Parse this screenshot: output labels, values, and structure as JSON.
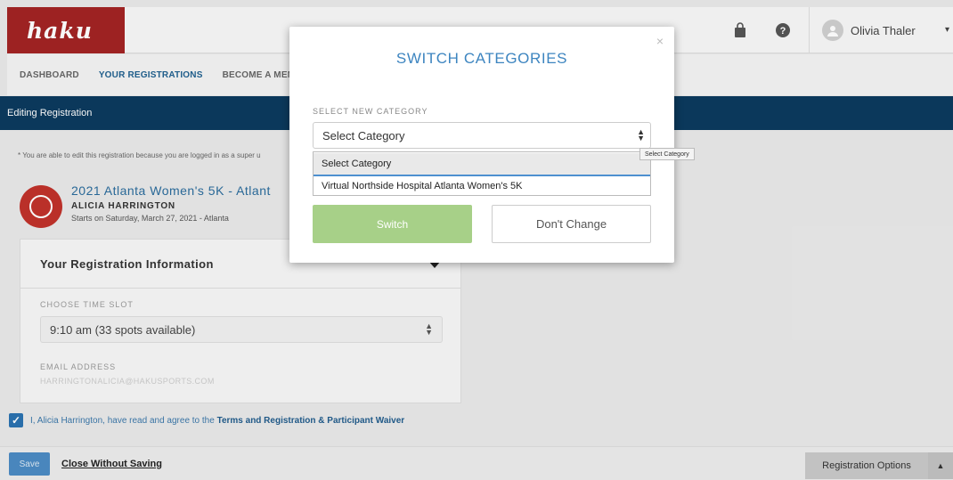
{
  "app": {
    "logo_text": "haku"
  },
  "header": {
    "user_name": "Olivia Thaler"
  },
  "nav": {
    "items": [
      "DASHBOARD",
      "YOUR REGISTRATIONS",
      "BECOME A MEMBE"
    ]
  },
  "edit_bar": {
    "title": "Editing Registration"
  },
  "notice": "* You are able to edit this registration because you are logged in as a super u",
  "event": {
    "title": "2021 Atlanta Women's 5K - Atlant",
    "person": "ALICIA HARRINGTON",
    "date": "Starts on Saturday, March 27, 2021 - Atlanta"
  },
  "registration_panel": {
    "title": "Your Registration Information",
    "time_slot_label": "CHOOSE TIME SLOT",
    "time_slot_value": "9:10 am (33 spots available)",
    "email_label": "EMAIL ADDRESS",
    "email_value": "HARRINGTONALICIA@HAKUSPORTS.COM"
  },
  "agreement": {
    "text": "I, Alicia Harrington, have read and agree to the ",
    "link": "Terms and Registration & Participant Waiver",
    "checked": true
  },
  "footer": {
    "save_label": "Save",
    "close_label": "Close Without Saving",
    "options_label": "Registration Options"
  },
  "modal": {
    "title": "SWITCH CATEGORIES",
    "close_glyph": "×",
    "select_label": "SELECT NEW CATEGORY",
    "select_value": "Select Category",
    "options": [
      "Select Category",
      "Virtual Northside Hospital Atlanta Women's 5K"
    ],
    "switch_label": "Switch",
    "dont_change_label": "Don't Change"
  },
  "tooltip": "Select Category",
  "colors": {
    "brand_red": "#a32424",
    "nav_dark": "#0c3a5e",
    "accent_blue": "#3d85c0",
    "switch_green": "#a7d088"
  },
  "icons": [
    "bag-icon",
    "help-icon",
    "avatar-icon",
    "chevron-down-icon",
    "close-icon",
    "check-icon",
    "chevron-up-icon"
  ]
}
